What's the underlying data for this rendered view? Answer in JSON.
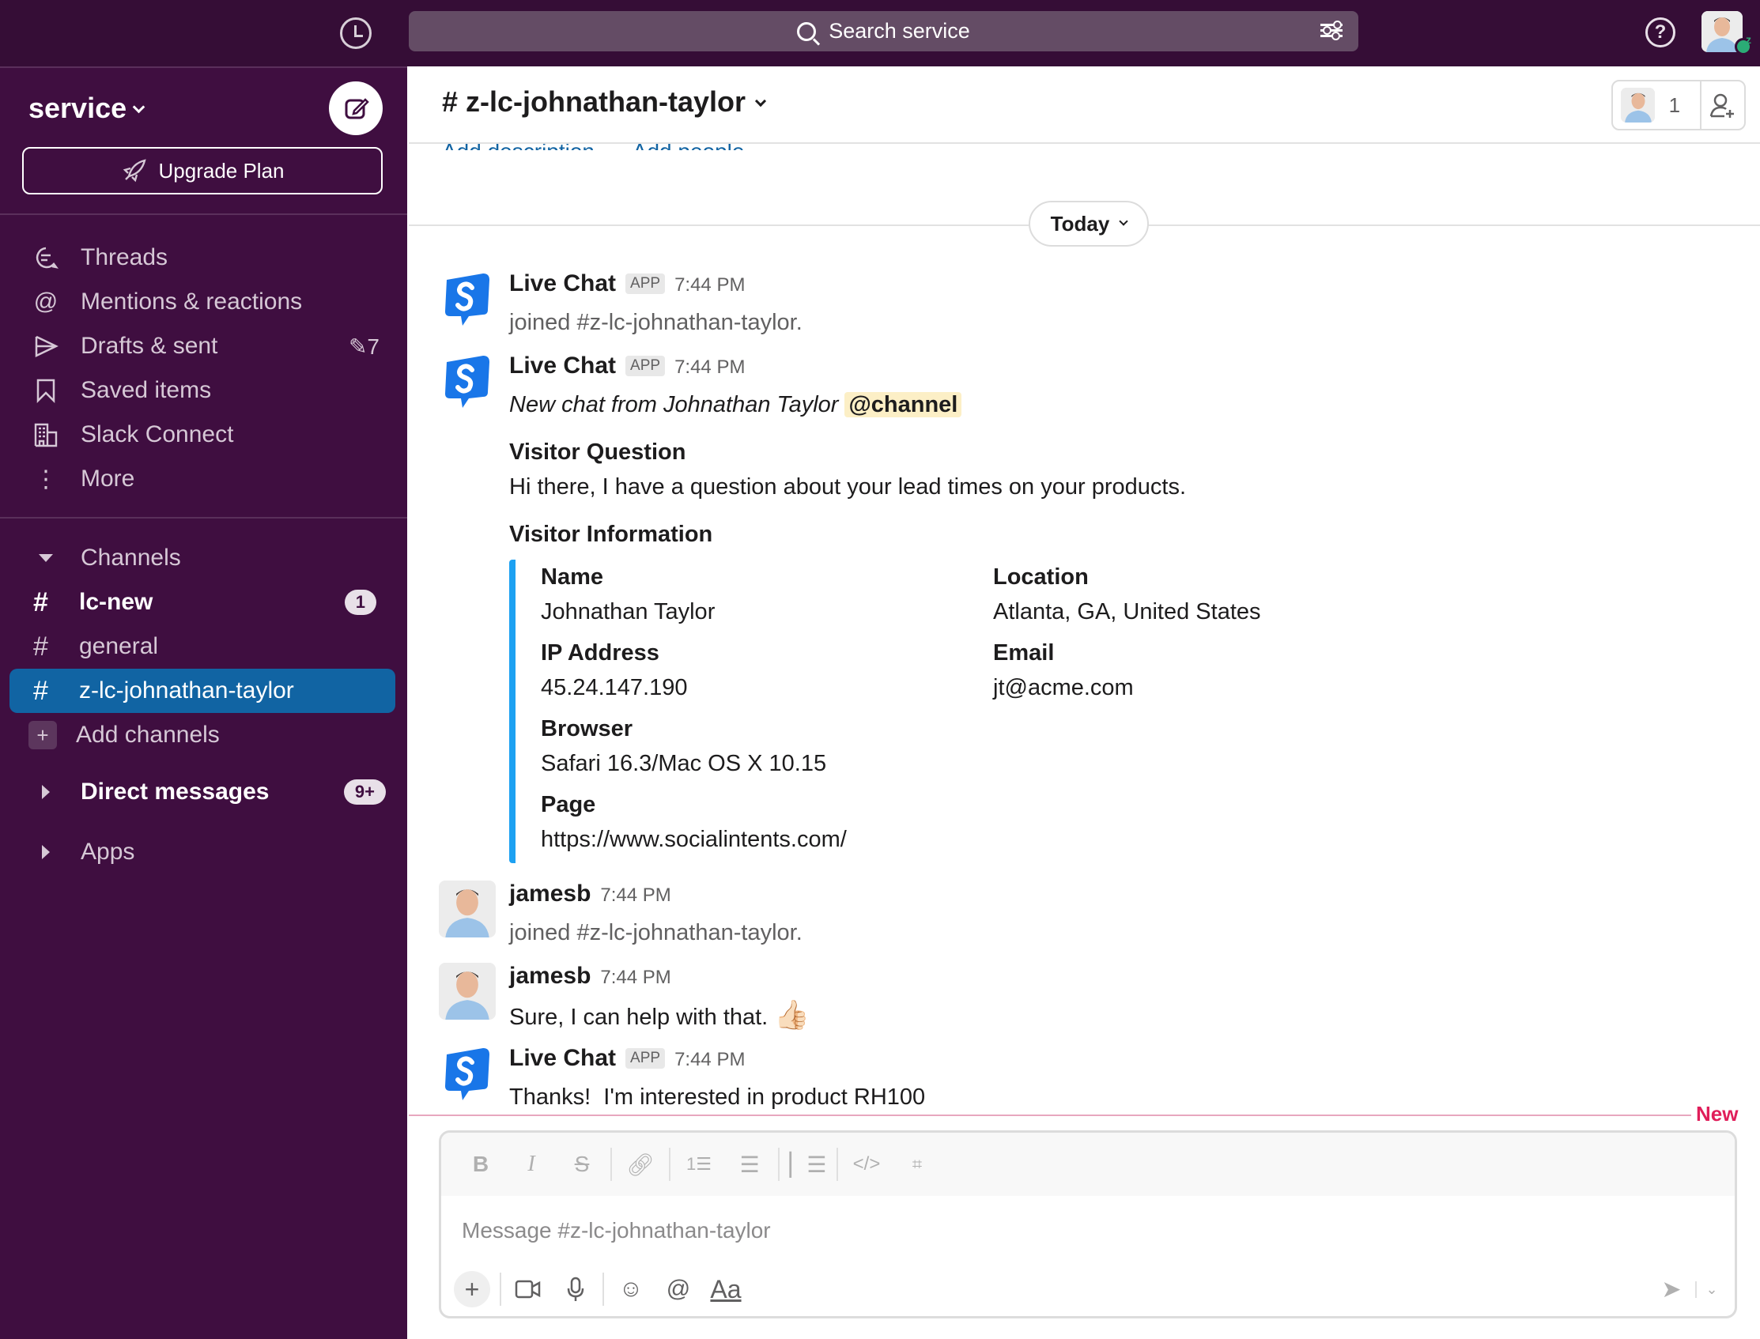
{
  "topbar": {
    "search_placeholder": "Search service",
    "icons": [
      "history-icon",
      "search-icon",
      "filter-icon",
      "help-icon"
    ],
    "status": "away-snooze"
  },
  "sidebar": {
    "workspace": "service",
    "upgrade_label": "Upgrade Plan",
    "nav": [
      {
        "label": "Threads",
        "icon": "threads-icon"
      },
      {
        "label": "Mentions & reactions",
        "icon": "mention-icon"
      },
      {
        "label": "Drafts & sent",
        "icon": "send-icon",
        "count": "7"
      },
      {
        "label": "Saved items",
        "icon": "bookmark-icon"
      },
      {
        "label": "Slack Connect",
        "icon": "building-icon"
      },
      {
        "label": "More",
        "icon": "more-vertical-icon"
      }
    ],
    "channels_header": "Channels",
    "channels": [
      {
        "name": "lc-new",
        "unread": true,
        "badge": "1"
      },
      {
        "name": "general",
        "unread": false
      },
      {
        "name": "z-lc-johnathan-taylor",
        "active": true
      }
    ],
    "add_channels": "Add channels",
    "dm_header": "Direct messages",
    "dm_badge": "9+",
    "apps_header": "Apps"
  },
  "channel": {
    "title": "# z-lc-johnathan-taylor",
    "member_count": "1",
    "add_description": "Add description",
    "add_people": "Add people",
    "date_divider": "Today"
  },
  "messages": [
    {
      "author": "Live Chat",
      "app_tag": "APP",
      "time": "7:44 PM",
      "text": "joined #z-lc-johnathan-taylor."
    },
    {
      "author": "Live Chat",
      "app_tag": "APP",
      "time": "7:44 PM",
      "text": "New chat from Johnathan Taylor",
      "mention": "@channel",
      "visitor_question_title": "Visitor Question",
      "visitor_question": "Hi there, I have a question about your lead times on your products.",
      "visitor_info_title": "Visitor Information",
      "fields": [
        {
          "label": "Name",
          "value": "Johnathan Taylor"
        },
        {
          "label": "Location",
          "value": "Atlanta, GA, United States"
        },
        {
          "label": "IP Address",
          "value": "45.24.147.190"
        },
        {
          "label": "Email",
          "value": "jt@acme.com"
        },
        {
          "label": "Browser",
          "value": "Safari 16.3/Mac OS X 10.15"
        },
        {
          "label": "Page",
          "value": "https://www.socialintents.com/"
        }
      ]
    },
    {
      "author": "jamesb",
      "time": "7:44 PM",
      "text": "joined #z-lc-johnathan-taylor."
    },
    {
      "author": "jamesb",
      "time": "7:44 PM",
      "text": "Sure, I can help with that.",
      "emoji": "👍🏻"
    },
    {
      "author": "Live Chat",
      "app_tag": "APP",
      "time": "7:44 PM",
      "text": "Thanks!  I'm interested in product RH100"
    }
  ],
  "new_divider": "New",
  "composer": {
    "placeholder": "Message #z-lc-johnathan-taylor",
    "format_label": "Aa"
  },
  "colors": {
    "sidebar": "#3f0e40",
    "topbar": "#350d36",
    "active_channel": "#1164a3",
    "attachment_bar": "#1da1f2",
    "new_divider": "#e01e5a",
    "mention_bg": "#fcefc6"
  }
}
